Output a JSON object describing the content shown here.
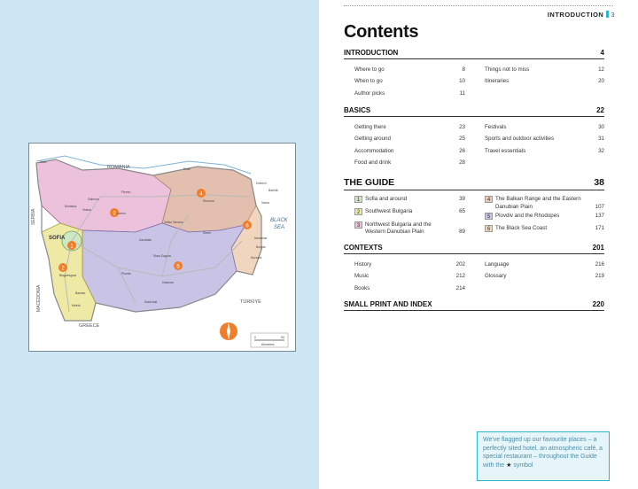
{
  "colors": {
    "accent": "#2eb5c9",
    "left_bg": "#cde6f3",
    "compass": "#f07d29"
  },
  "map": {
    "labels": {
      "romania": "ROMANIA",
      "serbia": "SERBIA",
      "macedonia": "MACEDONIA",
      "greece": "GREECE",
      "turkiye": "TÜRKIYE",
      "sea": [
        "BLACK",
        "SEA"
      ],
      "sofia": "SOFIA",
      "cities": [
        "Vidin",
        "Ruse",
        "Pleven",
        "Varna",
        "Burgas",
        "Plovdiv",
        "Blagoevgrad",
        "Shumen",
        "Dobrich",
        "Veliko Tarnovo",
        "Sliven",
        "Stara Zagora",
        "Haskovo",
        "Kardzhali",
        "Bansko",
        "Melnik",
        "Lovech",
        "Kazanlak",
        "Nessebar",
        "Sozopol",
        "Balchik",
        "Montana",
        "Vratsa",
        "Gabrovo",
        "Yambol",
        "Dimitrovgrad",
        "Smolyan",
        "Chiprovtsi",
        "Oryahovo",
        "Svishtov",
        "Etropole",
        "Karlovo",
        "Pamporovo",
        "Rila",
        "Samokov",
        "Sandanski",
        "Razlog",
        "Pazardzhik",
        "Kyustendil",
        "Belogradchik",
        "Lom",
        "Silistra",
        "Razgrad",
        "Tryavna",
        "Elena",
        "Kotel",
        "Pomorie",
        "Primorsko",
        "Tsarevo",
        "Ahtopol",
        "Elhovo",
        "Harmanli",
        "Svilengrad",
        "Madan",
        "Devin",
        "Velingrad",
        "Bratsigovo",
        "Batak",
        "Dupnitsa",
        "Pernik",
        "Botevgrad",
        "Troyan",
        "Teteven",
        "Koprivshtitsa",
        "Hisarya",
        "Chirpan",
        "Nova Zagora",
        "Karnobat",
        "Aytos",
        "Provadia",
        "Devnya",
        "Targovishte",
        "Popovo",
        "Isperih",
        "Tutrakan",
        "Kozloduy",
        "Byala Slatina",
        "Belene",
        "Nikopol",
        "Levski",
        "Dryanovo",
        "Strazhitsa",
        "Omurtag",
        "Preslav",
        "Novi Pazar",
        "Kavarna",
        "Shabla",
        "Obzor",
        "Byala",
        "Ruen",
        "Sungurlare",
        "Tvarditsa",
        "Radnevo",
        "Galabovo",
        "Topolovgrad",
        "Ivaylovgrad",
        "Krumovgrad",
        "Momchilgrad",
        "Zlatograd",
        "Rudozem",
        "Chepelare",
        "Asenovgrad",
        "Rakovski",
        "Stamboliyski",
        "Septemvri",
        "Panagyurishte",
        "Pirdop",
        "Zlatitsa",
        "Ihtiman",
        "Kostenets",
        "Dolna Banya",
        "Govedartsi",
        "Borovets",
        "Simitli",
        "Kresna",
        "Petrich",
        "Gotse Delchev",
        "Dospat",
        "Sarnitsa",
        "Satovcha",
        "Yakoruda",
        "Belitsa",
        "Trigrad",
        "Yagodina",
        "Shiroka Laka",
        "Gela",
        "Mugla"
      ],
      "scale": [
        "0",
        "50",
        "kilometres"
      ]
    },
    "regions": [
      "1",
      "2",
      "3",
      "4",
      "5",
      "6"
    ]
  },
  "header": {
    "running_head": "INTRODUCTION",
    "page_number": "3"
  },
  "title": "Contents",
  "sections": {
    "introduction": {
      "title": "INTRODUCTION",
      "page": "4",
      "left": [
        {
          "t": "Where to go",
          "p": "8"
        },
        {
          "t": "When to go",
          "p": "10"
        },
        {
          "t": "Author picks",
          "p": "11"
        }
      ],
      "right": [
        {
          "t": "Things not to miss",
          "p": "12"
        },
        {
          "t": "Itineraries",
          "p": "20"
        }
      ]
    },
    "basics": {
      "title": "BASICS",
      "page": "22",
      "left": [
        {
          "t": "Getting there",
          "p": "23"
        },
        {
          "t": "Getting around",
          "p": "25"
        },
        {
          "t": "Accommodation",
          "p": "26"
        },
        {
          "t": "Food and drink",
          "p": "28"
        }
      ],
      "right": [
        {
          "t": "Festivals",
          "p": "30"
        },
        {
          "t": "Sports and outdoor activities",
          "p": "31"
        },
        {
          "t": "Travel essentials",
          "p": "32"
        }
      ]
    },
    "guide": {
      "title": "THE GUIDE",
      "page": "38",
      "left": [
        {
          "n": "1",
          "t": "Sofia and around",
          "p": "39",
          "c": "#cfe8c4"
        },
        {
          "n": "2",
          "t": "Southwest Bulgaria",
          "p": "65",
          "c": "#efe9a6"
        },
        {
          "n": "3",
          "t": "Northwest Bulgaria and the Western Danubian Plain",
          "p": "89",
          "c": "#ecc1dc"
        }
      ],
      "right": [
        {
          "n": "4",
          "t": "The Balkan Range and the Eastern Danubian Plain",
          "p": "107",
          "c": "#ebcdb8"
        },
        {
          "n": "5",
          "t": "Plovdiv and the Rhodopes",
          "p": "137",
          "c": "#c9c3e6"
        },
        {
          "n": "6",
          "t": "The Black Sea Coast",
          "p": "171",
          "c": "#f1d6bf"
        }
      ]
    },
    "contexts": {
      "title": "CONTEXTS",
      "page": "201",
      "left": [
        {
          "t": "History",
          "p": "202"
        },
        {
          "t": "Music",
          "p": "212"
        },
        {
          "t": "Books",
          "p": "214"
        }
      ],
      "right": [
        {
          "t": "Language",
          "p": "216"
        },
        {
          "t": "Glossary",
          "p": "219"
        }
      ]
    },
    "small_print": {
      "title": "SMALL PRINT AND INDEX",
      "page": "220"
    }
  },
  "callout": {
    "text_before": "We've flagged up our favourite places – a perfectly sited hotel, an atmospheric café, a special restaurant – throughout the Guide with the",
    "star": "★",
    "text_after": "symbol"
  }
}
